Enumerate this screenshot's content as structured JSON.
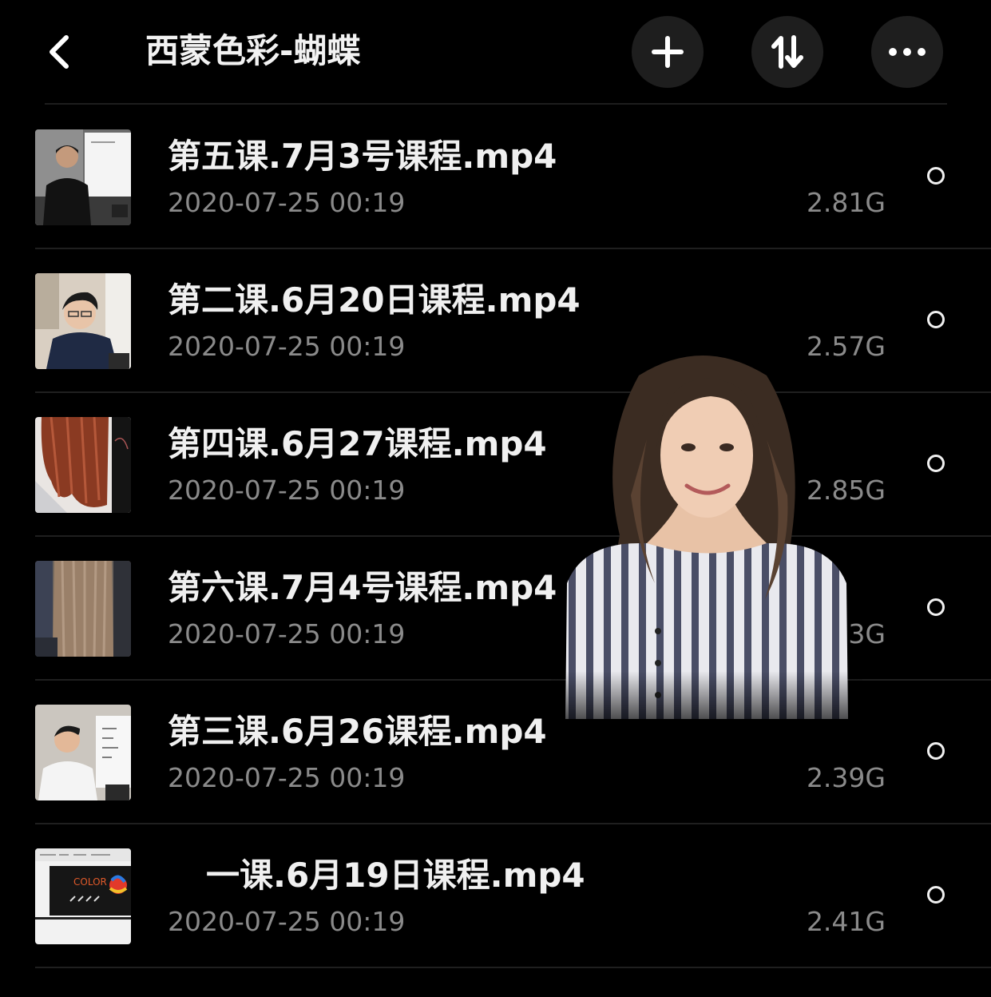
{
  "header": {
    "back_icon": "chevron-left-icon",
    "title": "西蒙色彩-蝴蝶",
    "add_icon": "plus-icon",
    "sort_icon": "sort-arrows-icon",
    "more_icon": "more-dots-icon"
  },
  "files": [
    {
      "name": "第五课.7月3号课程.mp4",
      "date": "2020-07-25 00:19",
      "size": "2.81G",
      "thumb": "teacher-whiteboard"
    },
    {
      "name": "第二课.6月20日课程.mp4",
      "date": "2020-07-25 00:19",
      "size": "2.57G",
      "thumb": "teacher-glasses"
    },
    {
      "name": "第四课.6月27课程.mp4",
      "date": "2020-07-25 00:19",
      "size": "2.85G",
      "thumb": "copper-hair"
    },
    {
      "name": "第六课.7月4号课程.mp4",
      "date": "2020-07-25 00:19",
      "size": "2.53G",
      "thumb": "ash-hair"
    },
    {
      "name": "第三课.6月26课程.mp4",
      "date": "2020-07-25 00:19",
      "size": "2.39G",
      "thumb": "teacher-white-shirt"
    },
    {
      "name": "一课.6月19日课程.mp4",
      "date": "2020-07-25 00:19",
      "size": "2.41G",
      "thumb": "color-slide",
      "thumb_text": "COLOR"
    }
  ],
  "colors": {
    "background": "#000000",
    "header_button_bg": "#1e1e1e",
    "primary_text": "#f0f0f0",
    "secondary_text": "#8a8a8a",
    "divider": "#1f1f1f"
  }
}
